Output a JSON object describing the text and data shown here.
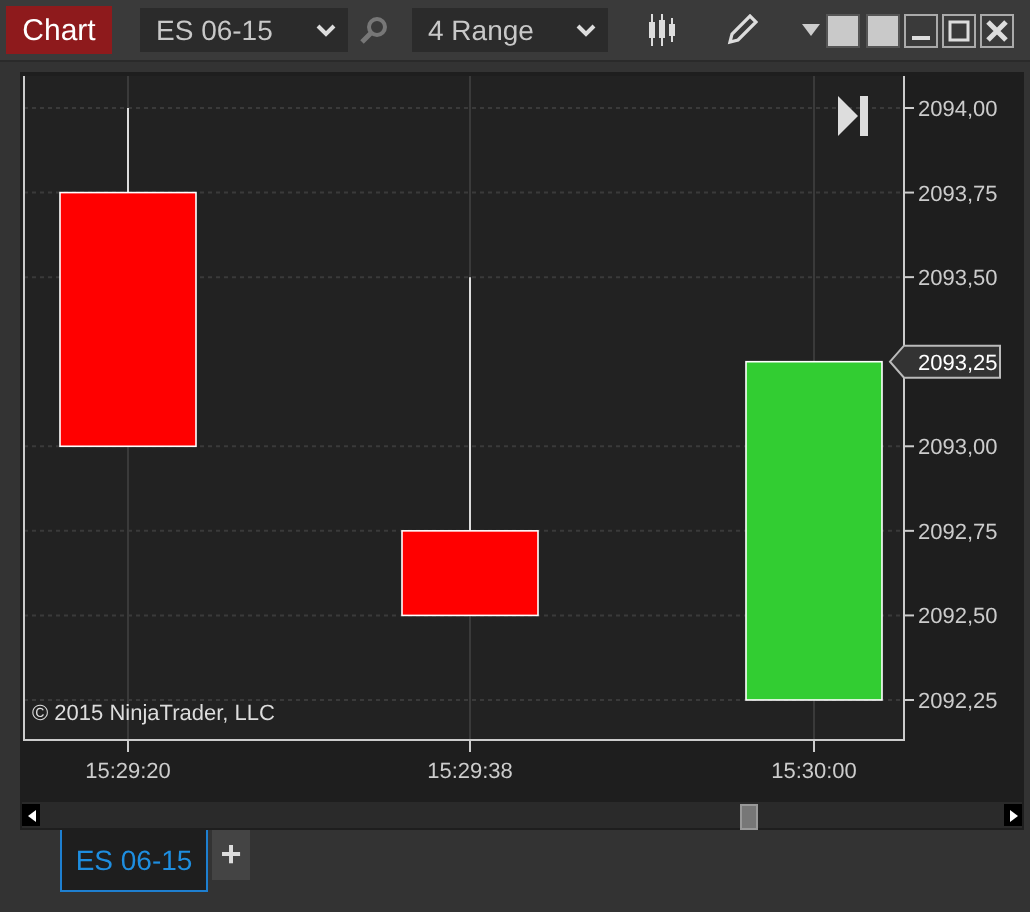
{
  "toolbar": {
    "title": "Chart",
    "instrument": "ES 06-15",
    "interval": "4 Range"
  },
  "chart": {
    "price_labels": [
      "2094,00",
      "2093,75",
      "2093,50",
      "2093,00",
      "2092,75",
      "2092,50",
      "2092,25"
    ],
    "time_labels": [
      "15:29:20",
      "15:29:38",
      "15:30:00"
    ],
    "candles": [
      {
        "kind": "bearish"
      },
      {
        "kind": "bearish"
      },
      {
        "kind": "bullish"
      }
    ],
    "current_price": "2093,25",
    "copyright": "© 2015 NinjaTrader, LLC"
  },
  "tabs": [
    {
      "label": "ES 06-15",
      "selected": true
    }
  ],
  "add_tab": "+"
}
